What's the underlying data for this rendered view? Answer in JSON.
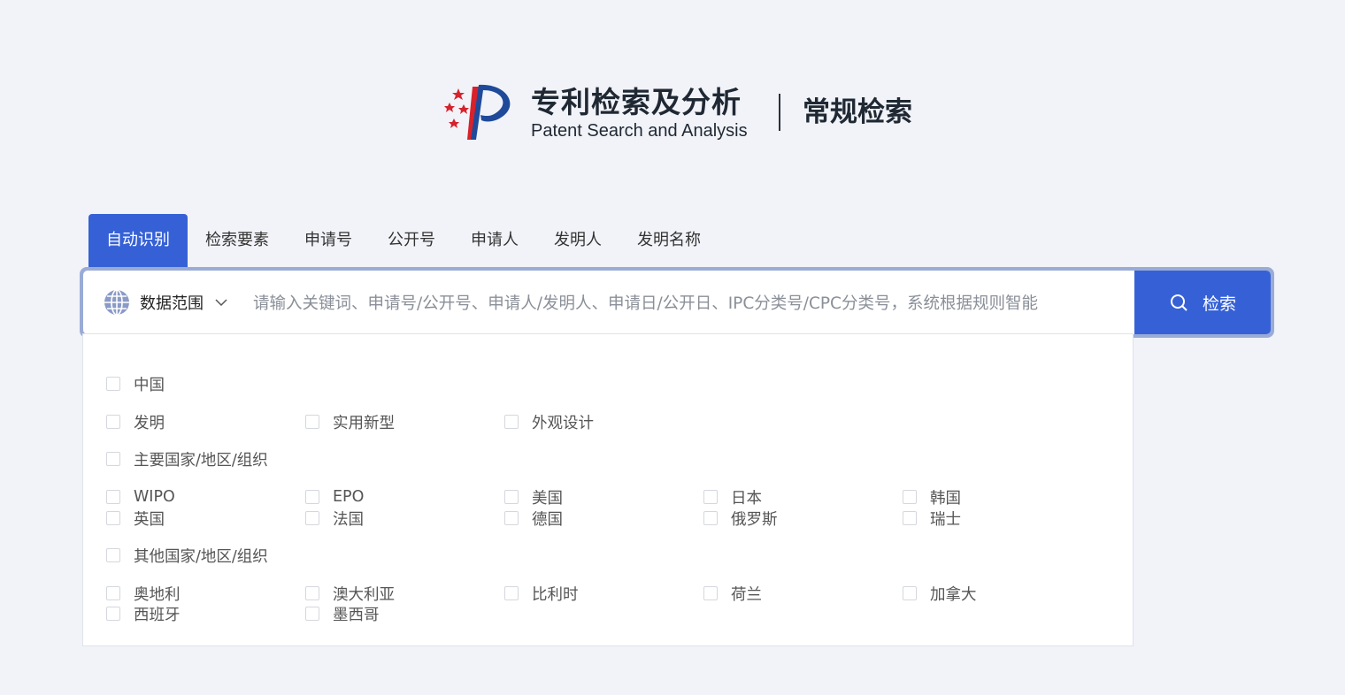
{
  "header": {
    "logo_cn": "专利检索及分析",
    "logo_en": "Patent Search and Analysis",
    "subtitle": "常规检索"
  },
  "tabs": [
    {
      "label": "自动识别",
      "active": true
    },
    {
      "label": "检索要素",
      "active": false
    },
    {
      "label": "申请号",
      "active": false
    },
    {
      "label": "公开号",
      "active": false
    },
    {
      "label": "申请人",
      "active": false
    },
    {
      "label": "发明人",
      "active": false
    },
    {
      "label": "发明名称",
      "active": false
    }
  ],
  "search": {
    "scope_label": "数据范围",
    "placeholder": "请输入关键词、申请号/公开号、申请人/发明人、申请日/公开日、IPC分类号/CPC分类号，系统根据规则智能",
    "button_label": "检索",
    "value": ""
  },
  "dropdown": {
    "china": "中国",
    "china_types": [
      "发明",
      "实用新型",
      "外观设计"
    ],
    "major": "主要国家/地区/组织",
    "major_items": [
      "WIPO",
      "EPO",
      "美国",
      "日本",
      "韩国",
      "英国",
      "法国",
      "德国",
      "俄罗斯",
      "瑞士"
    ],
    "other": "其他国家/地区/组织",
    "other_items": [
      "奥地利",
      "澳大利亚",
      "比利时",
      "荷兰",
      "加拿大",
      "西班牙",
      "墨西哥"
    ]
  },
  "colors": {
    "accent": "#3661d6",
    "background": "#f1f3f8",
    "search_border": "#9aabd6",
    "logo_red": "#d7222b",
    "logo_blue": "#1f4a9a"
  }
}
